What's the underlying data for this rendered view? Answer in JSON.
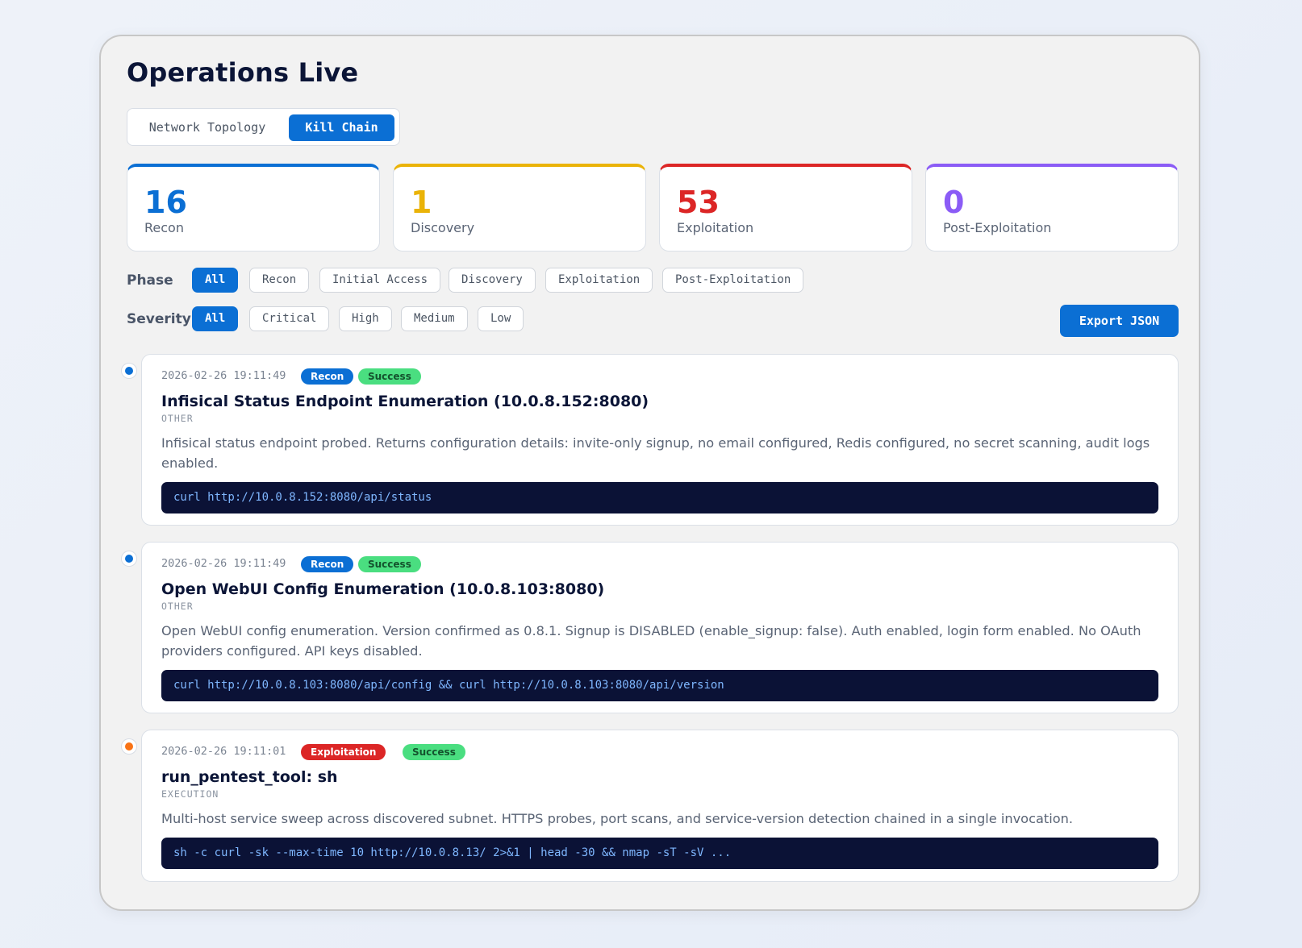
{
  "page": {
    "title": "Operations Live",
    "tabs": [
      {
        "label": "Network Topology",
        "active": false
      },
      {
        "label": "Kill Chain",
        "active": true
      }
    ]
  },
  "stats": [
    {
      "value": "16",
      "label": "Recon",
      "color": "#0b6fd4"
    },
    {
      "value": "1",
      "label": "Discovery",
      "color": "#eab308"
    },
    {
      "value": "53",
      "label": "Exploitation",
      "color": "#dc2626"
    },
    {
      "value": "0",
      "label": "Post-Exploitation",
      "color": "#8b5cf6"
    }
  ],
  "filters": {
    "phase_label": "Phase",
    "phase": [
      "All",
      "Recon",
      "Initial Access",
      "Discovery",
      "Exploitation",
      "Post-Exploitation"
    ],
    "severity_label": "Severity",
    "severity": [
      "All",
      "Critical",
      "High",
      "Medium",
      "Low"
    ],
    "active_phase": "All",
    "active_severity": "All"
  },
  "export_label": "Export JSON",
  "events": [
    {
      "timestamp": "2026-02-26 19:11:49",
      "phase": "Recon",
      "status": "Success",
      "dot_color": "#0b6fd4",
      "title": "Infisical Status Endpoint Enumeration (10.0.8.152:8080)",
      "category": "OTHER",
      "description": "Infisical status endpoint probed. Returns configuration details: invite-only signup, no email configured, Redis configured, no secret scanning, audit logs enabled.",
      "command": "curl http://10.0.8.152:8080/api/status"
    },
    {
      "timestamp": "2026-02-26 19:11:49",
      "phase": "Recon",
      "status": "Success",
      "dot_color": "#0b6fd4",
      "title": "Open WebUI Config Enumeration (10.0.8.103:8080)",
      "category": "OTHER",
      "description": "Open WebUI config enumeration. Version confirmed as 0.8.1. Signup is DISABLED (enable_signup: false). Auth enabled, login form enabled. No OAuth providers configured. API keys disabled.",
      "command": "curl http://10.0.8.103:8080/api/config && curl http://10.0.8.103:8080/api/version"
    },
    {
      "timestamp": "2026-02-26 19:11:01",
      "phase": "Exploitation",
      "status": "Success",
      "dot_color": "#f97316",
      "title": "run_pentest_tool: sh",
      "category": "EXECUTION",
      "description": "Multi-host service sweep across discovered subnet. HTTPS probes, port scans, and service-version detection chained in a single invocation.",
      "command": "sh -c curl -sk --max-time 10 http://10.0.8.13/ 2>&1 | head -30 && nmap -sT -sV ..."
    }
  ]
}
